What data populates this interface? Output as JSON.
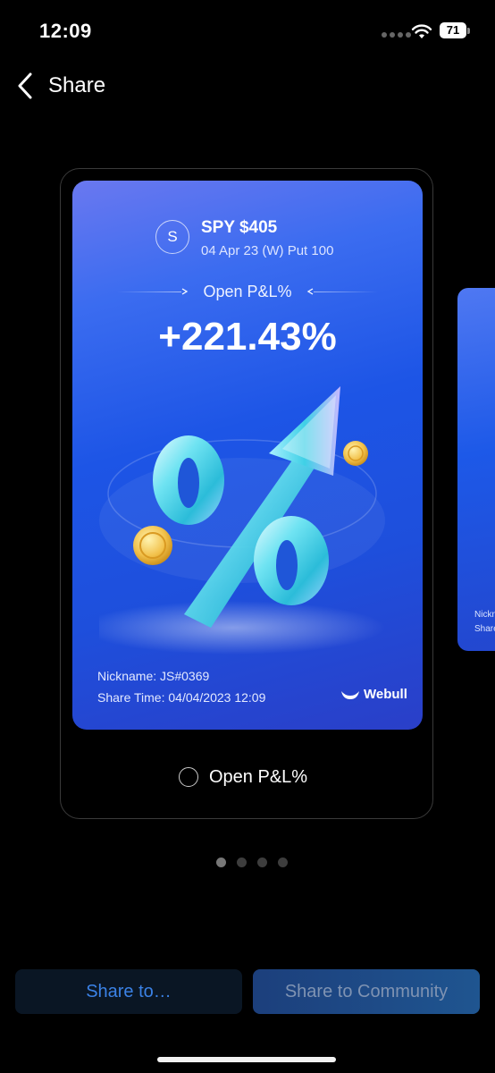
{
  "status_bar": {
    "time": "12:09",
    "battery": "71"
  },
  "header": {
    "back_icon": "chevron-left-icon",
    "title": "Share"
  },
  "card": {
    "avatar_letter": "S",
    "symbol_title": "SPY $405",
    "symbol_sub": "04 Apr 23 (W) Put 100",
    "pnl_label": "Open P&L%",
    "pnl_value": "+221.43%",
    "nickname": "Nickname: JS#0369",
    "share_time": "Share Time: 04/04/2023 12:09",
    "brand": "Webull"
  },
  "next_card": {
    "nick_partial": "Nickn",
    "share_partial": "Share"
  },
  "option": {
    "label": "Open P&L%",
    "selected": false
  },
  "pager": {
    "count": 4,
    "active_index": 0
  },
  "buttons": {
    "share_to": "Share to…",
    "share_community": "Share to Community"
  },
  "colors": {
    "card_blue": "#1d55e6",
    "link_blue": "#3b82e6"
  }
}
